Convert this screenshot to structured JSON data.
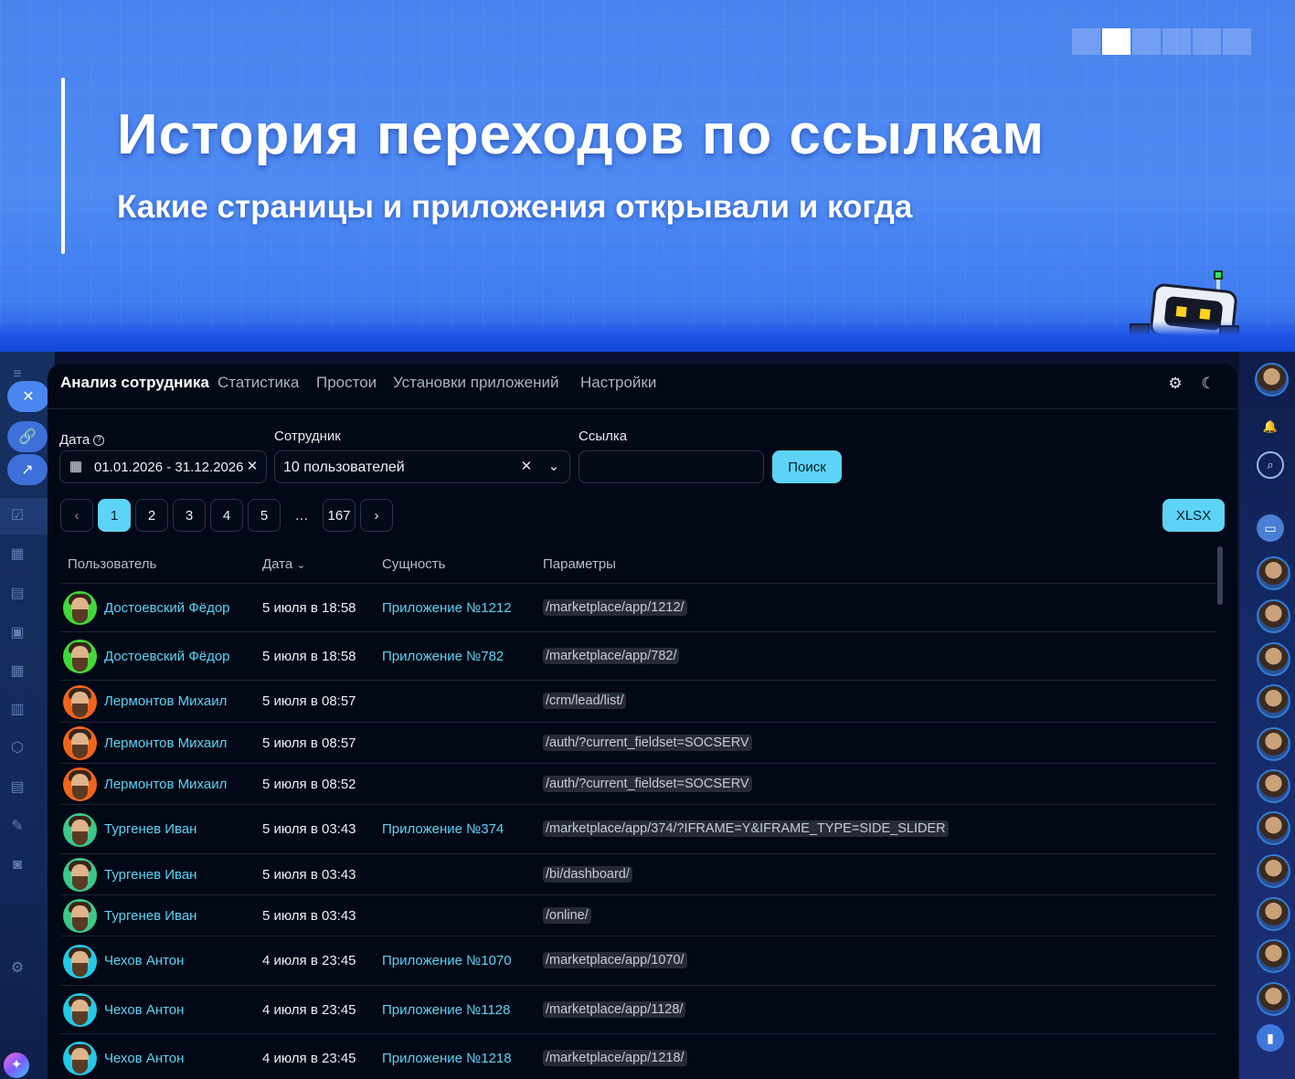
{
  "hero": {
    "title": "История переходов по ссылкам",
    "subtitle": "Какие страницы и приложения открывали и когда",
    "slide_count": 6,
    "active_slide": 2
  },
  "nav": {
    "tabs": [
      {
        "label": "Анализ сотрудника",
        "active": true
      },
      {
        "label": "Статистика",
        "active": false
      },
      {
        "label": "Простои",
        "active": false
      },
      {
        "label": "Установки приложений",
        "active": false
      },
      {
        "label": "Настройки",
        "active": false
      }
    ]
  },
  "filters": {
    "date": {
      "label": "Дата",
      "value": "01.01.2026 - 31.12.2026"
    },
    "employee": {
      "label": "Сотрудник",
      "value": "10 пользователей"
    },
    "link": {
      "label": "Ссылка",
      "value": ""
    },
    "search_button": "Поиск"
  },
  "pagination": {
    "pages": [
      "1",
      "2",
      "3",
      "4",
      "5",
      "…",
      "167"
    ],
    "current": "1"
  },
  "export_button": "XLSX",
  "table": {
    "columns": [
      "Пользователь",
      "Дата",
      "Сущность",
      "Параметры"
    ],
    "rows": [
      {
        "user": "Достоевский Фёдор",
        "date": "5 июля в 18:58",
        "entity": "Приложение №1212",
        "params": "/marketplace/app/1212/"
      },
      {
        "user": "Достоевский Фёдор",
        "date": "5 июля в 18:58",
        "entity": "Приложение №782",
        "params": "/marketplace/app/782/"
      },
      {
        "user": "Лермонтов Михаил",
        "date": "5 июля в 08:57",
        "entity": "",
        "params": "/crm/lead/list/"
      },
      {
        "user": "Лермонтов Михаил",
        "date": "5 июля в 08:57",
        "entity": "",
        "params": "/auth/?current_fieldset=SOCSERV"
      },
      {
        "user": "Лермонтов Михаил",
        "date": "5 июля в 08:52",
        "entity": "",
        "params": "/auth/?current_fieldset=SOCSERV"
      },
      {
        "user": "Тургенев Иван",
        "date": "5 июля в 03:43",
        "entity": "Приложение №374",
        "params": "/marketplace/app/374/?IFRAME=Y&IFRAME_TYPE=SIDE_SLIDER"
      },
      {
        "user": "Тургенев Иван",
        "date": "5 июля в 03:43",
        "entity": "",
        "params": "/bi/dashboard/"
      },
      {
        "user": "Тургенев Иван",
        "date": "5 июля в 03:43",
        "entity": "",
        "params": "/online/"
      },
      {
        "user": "Чехов Антон",
        "date": "4 июля в 23:45",
        "entity": "Приложение №1070",
        "params": "/marketplace/app/1070/"
      },
      {
        "user": "Чехов Антон",
        "date": "4 июля в 23:45",
        "entity": "Приложение №1128",
        "params": "/marketplace/app/1128/"
      },
      {
        "user": "Чехов Антон",
        "date": "4 июля в 23:45",
        "entity": "Приложение №1218",
        "params": "/marketplace/app/1218/"
      }
    ]
  },
  "colors": {
    "accent": "#5dd3f5",
    "panel_bg": "#020816",
    "hero_blue": "#4d8af2",
    "avatar_rings": {
      "Достоевский Фёдор": "#3fd93a",
      "Лермонтов Михаил": "#f0641c",
      "Тургенев Иван": "#3bc98a",
      "Чехов Антон": "#22c9e8"
    }
  },
  "icons": {
    "settings": "gear-icon",
    "theme": "moon-icon",
    "calendar": "calendar-icon",
    "clear": "close-icon",
    "dropdown": "chevron-down-icon",
    "sort": "sort-chevron-icon",
    "notifications": "bell-icon",
    "rail_search": "search-icon"
  }
}
